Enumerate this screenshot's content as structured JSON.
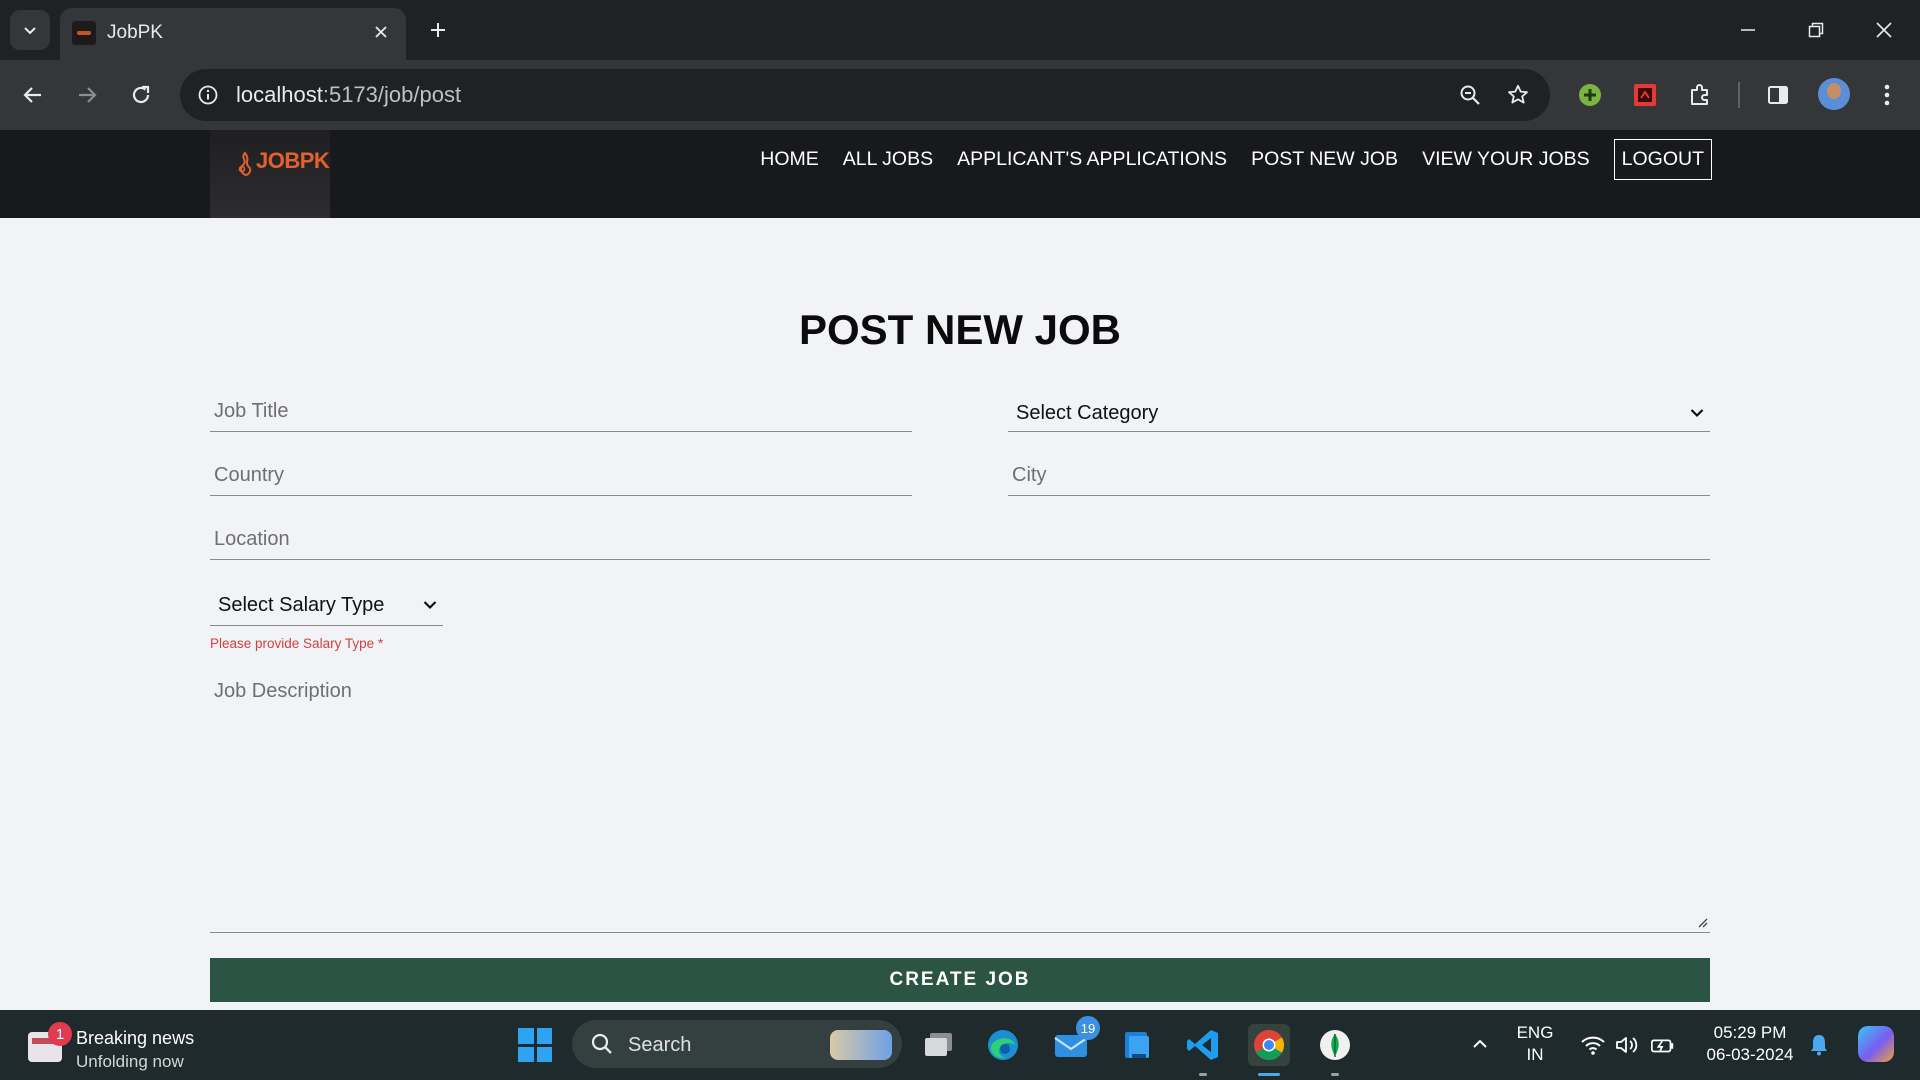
{
  "browser": {
    "tab_title": "JobPK",
    "url_host": "localhost",
    "url_rest": ":5173/job/post"
  },
  "app": {
    "logo_text": "JOBPK",
    "nav": {
      "home": "HOME",
      "all_jobs": "ALL JOBS",
      "applications": "APPLICANT'S APPLICATIONS",
      "post_job": "POST NEW JOB",
      "view_jobs": "VIEW YOUR JOBS",
      "logout": "LOGOUT"
    },
    "colors": {
      "nav_bg": "#18191c",
      "logo": "#e2622d",
      "button_bg": "#2c5444",
      "error": "#d0423a",
      "page_bg": "#f1f3f6"
    }
  },
  "form": {
    "title": "POST NEW JOB",
    "job_title": {
      "placeholder": "Job Title",
      "value": ""
    },
    "category": {
      "selected": "Select Category"
    },
    "country": {
      "placeholder": "Country",
      "value": ""
    },
    "city": {
      "placeholder": "City",
      "value": ""
    },
    "location": {
      "placeholder": "Location",
      "value": ""
    },
    "salary_type": {
      "selected": "Select Salary Type"
    },
    "salary_error": "Please provide Salary Type *",
    "description": {
      "placeholder": "Job Description",
      "value": ""
    },
    "submit_label": "CREATE JOB"
  },
  "taskbar": {
    "news_badge": "1",
    "news_title": "Breaking news",
    "news_sub": "Unfolding now",
    "search_label": "Search",
    "mail_badge": "19",
    "lang_line1": "ENG",
    "lang_line2": "IN",
    "time": "05:29 PM",
    "date": "06-03-2024"
  }
}
